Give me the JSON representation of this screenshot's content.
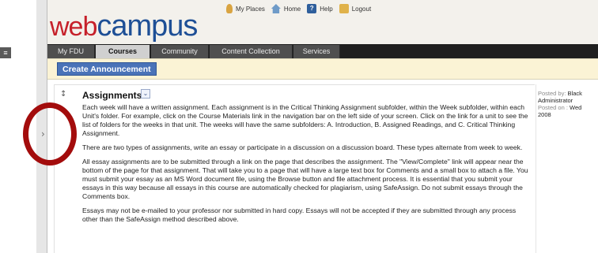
{
  "header": {
    "logo_web": "web",
    "logo_campus": "campus",
    "util_nav": [
      {
        "label": "My Places",
        "icon": "places-icon"
      },
      {
        "label": "Home",
        "icon": "home-icon"
      },
      {
        "label": "Help",
        "icon": "help-icon"
      },
      {
        "label": "Logout",
        "icon": "logout-icon"
      }
    ]
  },
  "tabs": [
    {
      "label": "My FDU"
    },
    {
      "label": "Courses",
      "active": true
    },
    {
      "label": "Community"
    },
    {
      "label": "Content Collection"
    },
    {
      "label": "Services"
    }
  ],
  "action_bar": {
    "create_label": "Create Announcement"
  },
  "item": {
    "title": "Assignments",
    "paragraphs": [
      "Each week will have a written assignment. Each assignment is in the Critical Thinking Assignment subfolder, within the Week subfolder, within each Unit's folder. For example, click on the Course Materials link in the navigation bar on the left side of your screen. Click on the link for a unit to see the list of folders for the weeks in that unit. The weeks will have the same subfolders: A. Introduction, B. Assigned Readings, and C. Critical Thinking Assignment.",
      "There are two types of assignments, write an essay or participate in a discussion on a discussion board. These types alternate from week to week.",
      "All essay assignments are to be submitted through a link on the page that describes the assignment. The \"View/Complete\" link will appear near the bottom of the page for that assignment. That will take you to a page that will have a large text box for Comments and a small box to attach a file. You must submit your essay as an MS Word document file, using the Browse button and file attachment process. It is essential that you submit your essays in this way because all essays in this course are automatically checked for plagiarism, using SafeAssign. Do not submit essays through the Comments box.",
      "Essays may not be e-mailed to your professor nor submitted in hard copy. Essays will not be accepted if they are submitted through any process other than the SafeAssign method described above."
    ]
  },
  "meta": {
    "posted_by_label": "Posted by:",
    "posted_by_value": "Black",
    "posted_by_line2": "Administrator",
    "posted_on_label": "Posted on :",
    "posted_on_value": "Wed",
    "posted_on_line2": "2008"
  },
  "colors": {
    "logo_web": "#c6202a",
    "logo_campus": "#1e4f96",
    "tab_bar": "#1f1f1f",
    "action_bar": "#fbf3d5",
    "create_button": "#4a73b8",
    "annotation_ring": "#a30c0c"
  }
}
